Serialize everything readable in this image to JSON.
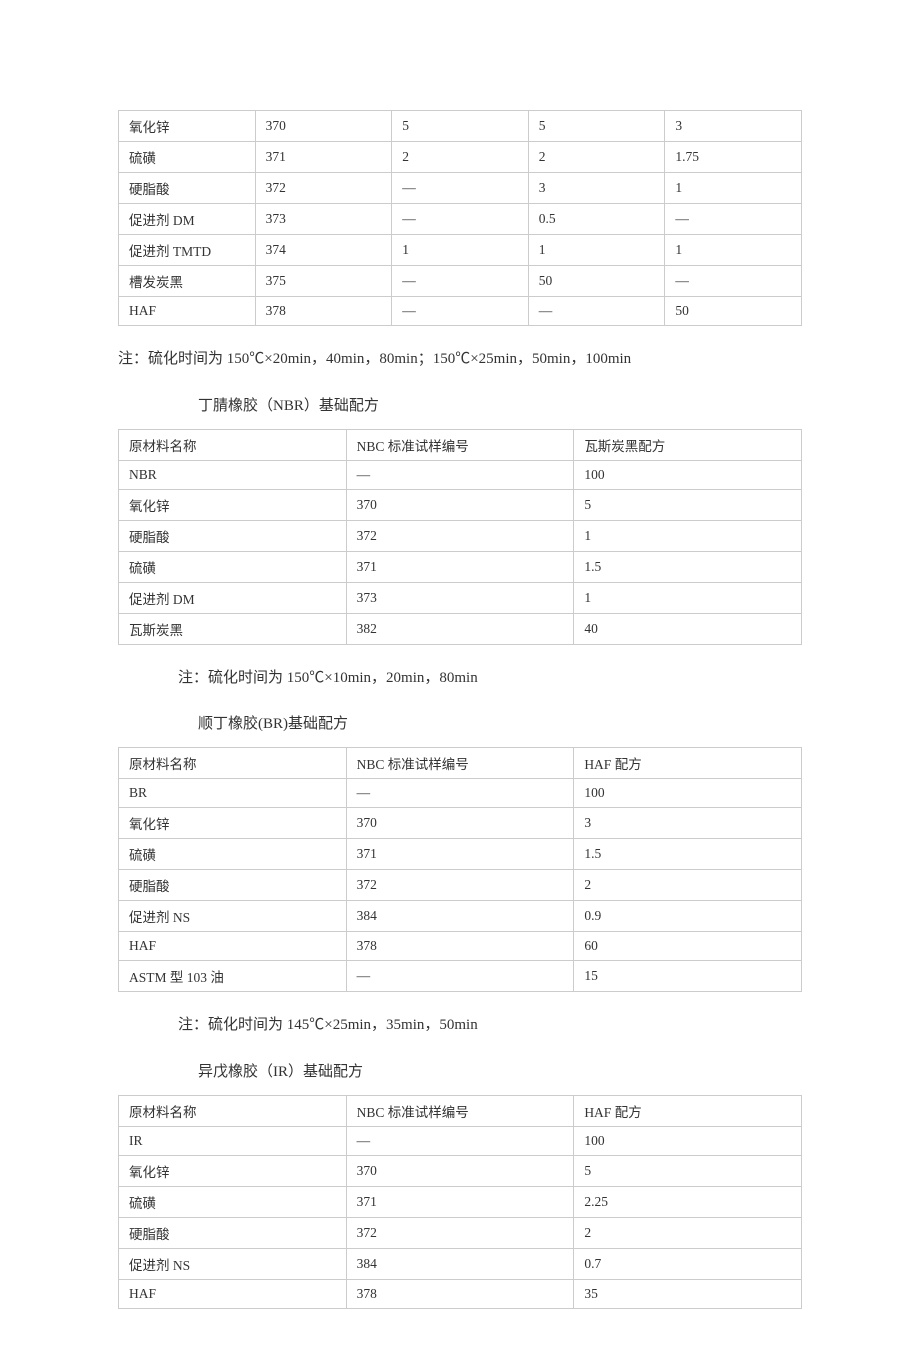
{
  "table1": {
    "rows": [
      {
        "c1": "氧化锌",
        "c2": "370",
        "c3": "5",
        "c4": "5",
        "c5": "3"
      },
      {
        "c1": "硫磺",
        "c2": "371",
        "c3": "2",
        "c4": "2",
        "c5": "1.75"
      },
      {
        "c1": "硬脂酸",
        "c2": "372",
        "c3": "—",
        "c4": "3",
        "c5": "1"
      },
      {
        "c1": "促进剂 DM",
        "c2": "373",
        "c3": "—",
        "c4": "0.5",
        "c5": "—"
      },
      {
        "c1": "促进剂 TMTD",
        "c2": "374",
        "c3": "1",
        "c4": "1",
        "c5": "1"
      },
      {
        "c1": "槽发炭黑",
        "c2": "375",
        "c3": "—",
        "c4": "50",
        "c5": "—"
      },
      {
        "c1": "HAF",
        "c2": "378",
        "c3": "—",
        "c4": "—",
        "c5": "50"
      }
    ]
  },
  "note1": "注：硫化时间为 150℃×20min，40min，80min；150℃×25min，50min，100min",
  "sec2": {
    "heading": "丁腈橡胶（NBR）基础配方",
    "headers": {
      "h1": "原材料名称",
      "h2": "NBC 标准试样编号",
      "h3": "瓦斯炭黑配方"
    },
    "rows": [
      {
        "c1": "NBR",
        "c2": "—",
        "c3": "100"
      },
      {
        "c1": "氧化锌",
        "c2": "370",
        "c3": "5"
      },
      {
        "c1": "硬脂酸",
        "c2": "372",
        "c3": "1"
      },
      {
        "c1": "硫磺",
        "c2": "371",
        "c3": "1.5"
      },
      {
        "c1": "促进剂 DM",
        "c2": "373",
        "c3": "1"
      },
      {
        "c1": "瓦斯炭黑",
        "c2": "382",
        "c3": "40"
      }
    ],
    "note": "注：硫化时间为 150℃×10min，20min，80min"
  },
  "sec3": {
    "heading": "顺丁橡胶(BR)基础配方",
    "headers": {
      "h1": "原材料名称",
      "h2": "NBC 标准试样编号",
      "h3": "HAF 配方"
    },
    "rows": [
      {
        "c1": "BR",
        "c2": "—",
        "c3": "100"
      },
      {
        "c1": "氧化锌",
        "c2": "370",
        "c3": "3"
      },
      {
        "c1": "硫磺",
        "c2": "371",
        "c3": "1.5"
      },
      {
        "c1": "硬脂酸",
        "c2": "372",
        "c3": "2"
      },
      {
        "c1": "促进剂 NS",
        "c2": "384",
        "c3": "0.9"
      },
      {
        "c1": "HAF",
        "c2": "378",
        "c3": "60"
      },
      {
        "c1": "ASTM 型 103 油",
        "c2": "—",
        "c3": "15"
      }
    ],
    "note": "注：硫化时间为 145℃×25min，35min，50min"
  },
  "sec4": {
    "heading": "异戊橡胶（IR）基础配方",
    "headers": {
      "h1": "原材料名称",
      "h2": "NBC 标准试样编号",
      "h3": "HAF 配方"
    },
    "rows": [
      {
        "c1": "IR",
        "c2": "—",
        "c3": "100"
      },
      {
        "c1": "氧化锌",
        "c2": "370",
        "c3": "5"
      },
      {
        "c1": "硫磺",
        "c2": "371",
        "c3": "2.25"
      },
      {
        "c1": "硬脂酸",
        "c2": "372",
        "c3": "2"
      },
      {
        "c1": "促进剂 NS",
        "c2": "384",
        "c3": "0.7"
      },
      {
        "c1": "HAF",
        "c2": "378",
        "c3": "35"
      }
    ]
  }
}
